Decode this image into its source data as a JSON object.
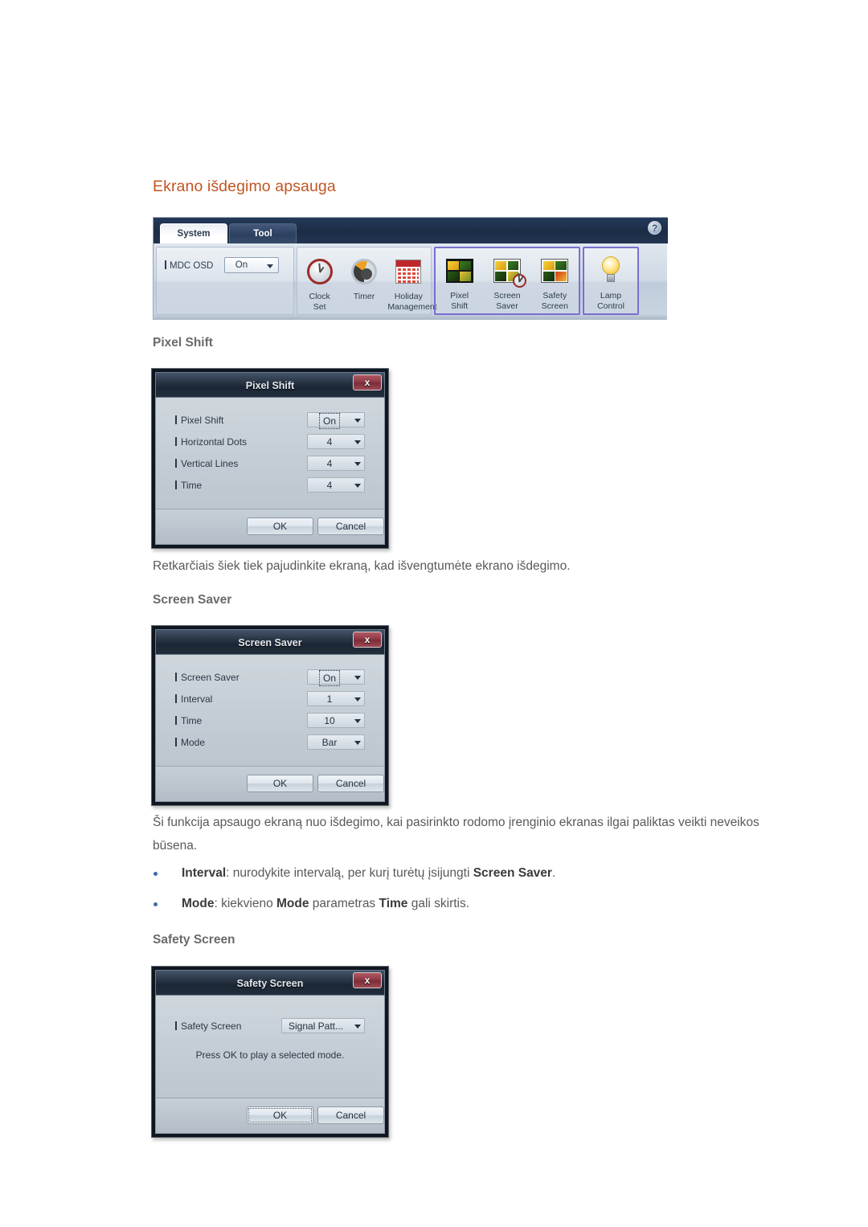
{
  "document": {
    "page_heading": "Ekrano išdegimo apsauga",
    "section_headings": {
      "pixel_shift": "Pixel Shift",
      "screen_saver": "Screen Saver",
      "safety_screen": "Safety Screen"
    },
    "paragraphs": {
      "pixel_shift_desc": "Retkarčiais šiek tiek pajudinkite ekraną, kad išvengtumėte ekrano išdegimo.",
      "screen_saver_desc": "Ši funkcija apsaugo ekraną nuo išdegimo, kai pasirinkto rodomo įrenginio ekranas ilgai paliktas veikti neveikos būsena."
    },
    "bullets": [
      {
        "lead": "Interval",
        "text_before": ": nurodykite intervalą, per kurį turėtų įsijungti ",
        "emphasis": "Screen Saver",
        "text_after": "."
      },
      {
        "lead": "Mode",
        "text_before": ": kiekvieno ",
        "emphasis": "Mode",
        "text_mid": " parametras ",
        "emphasis2": "Time",
        "text_after": " gali skirtis."
      }
    ],
    "colors": {
      "heading": "#C25523",
      "body_text": "#58595b",
      "bullet_dot": "#3e6ba8",
      "ribbon_highlight": "#7a6fd0",
      "dialog_close": "#8e3a46"
    }
  },
  "mdc_toolbar": {
    "tabs": [
      {
        "label": "System",
        "active": true
      },
      {
        "label": "Tool",
        "active": false
      }
    ],
    "help_icon": "?",
    "osd_group": {
      "label": "MDC OSD",
      "value": "On"
    },
    "clock_group": [
      {
        "icon": "clock-icon",
        "line1": "Clock",
        "line2": "Set"
      },
      {
        "icon": "timer-icon",
        "line1": "Timer",
        "line2": ""
      },
      {
        "icon": "calendar-icon",
        "line1": "Holiday",
        "line2": "Management"
      }
    ],
    "screen_burn_group": [
      {
        "icon": "pixel-tiles-icon",
        "line1": "Pixel",
        "line2": "Shift"
      },
      {
        "icon": "saver-tiles-icon",
        "line1": "Screen",
        "line2": "Saver"
      },
      {
        "icon": "safety-tiles-icon",
        "line1": "Safety",
        "line2": "Screen"
      }
    ],
    "lamp_group": [
      {
        "icon": "lamp-icon",
        "line1": "Lamp",
        "line2": "Control"
      }
    ]
  },
  "dialogs": {
    "pixel_shift": {
      "title": "Pixel Shift",
      "close_label": "x",
      "rows": [
        {
          "label": "Pixel Shift",
          "value": "On",
          "focused": true
        },
        {
          "label": "Horizontal Dots",
          "value": "4",
          "focused": false
        },
        {
          "label": "Vertical Lines",
          "value": "4",
          "focused": false
        },
        {
          "label": "Time",
          "value": "4",
          "focused": false
        }
      ],
      "ok_label": "OK",
      "cancel_label": "Cancel"
    },
    "screen_saver": {
      "title": "Screen Saver",
      "close_label": "x",
      "rows": [
        {
          "label": "Screen Saver",
          "value": "On",
          "focused": true
        },
        {
          "label": "Interval",
          "value": "1",
          "focused": false
        },
        {
          "label": "Time",
          "value": "10",
          "focused": false
        },
        {
          "label": "Mode",
          "value": "Bar",
          "focused": false
        }
      ],
      "ok_label": "OK",
      "cancel_label": "Cancel"
    },
    "safety_screen": {
      "title": "Safety Screen",
      "close_label": "x",
      "rows": [
        {
          "label": "Safety Screen",
          "value": "Signal Patt...",
          "focused": false
        }
      ],
      "note": "Press OK to play a selected mode.",
      "ok_label": "OK",
      "cancel_label": "Cancel"
    }
  }
}
